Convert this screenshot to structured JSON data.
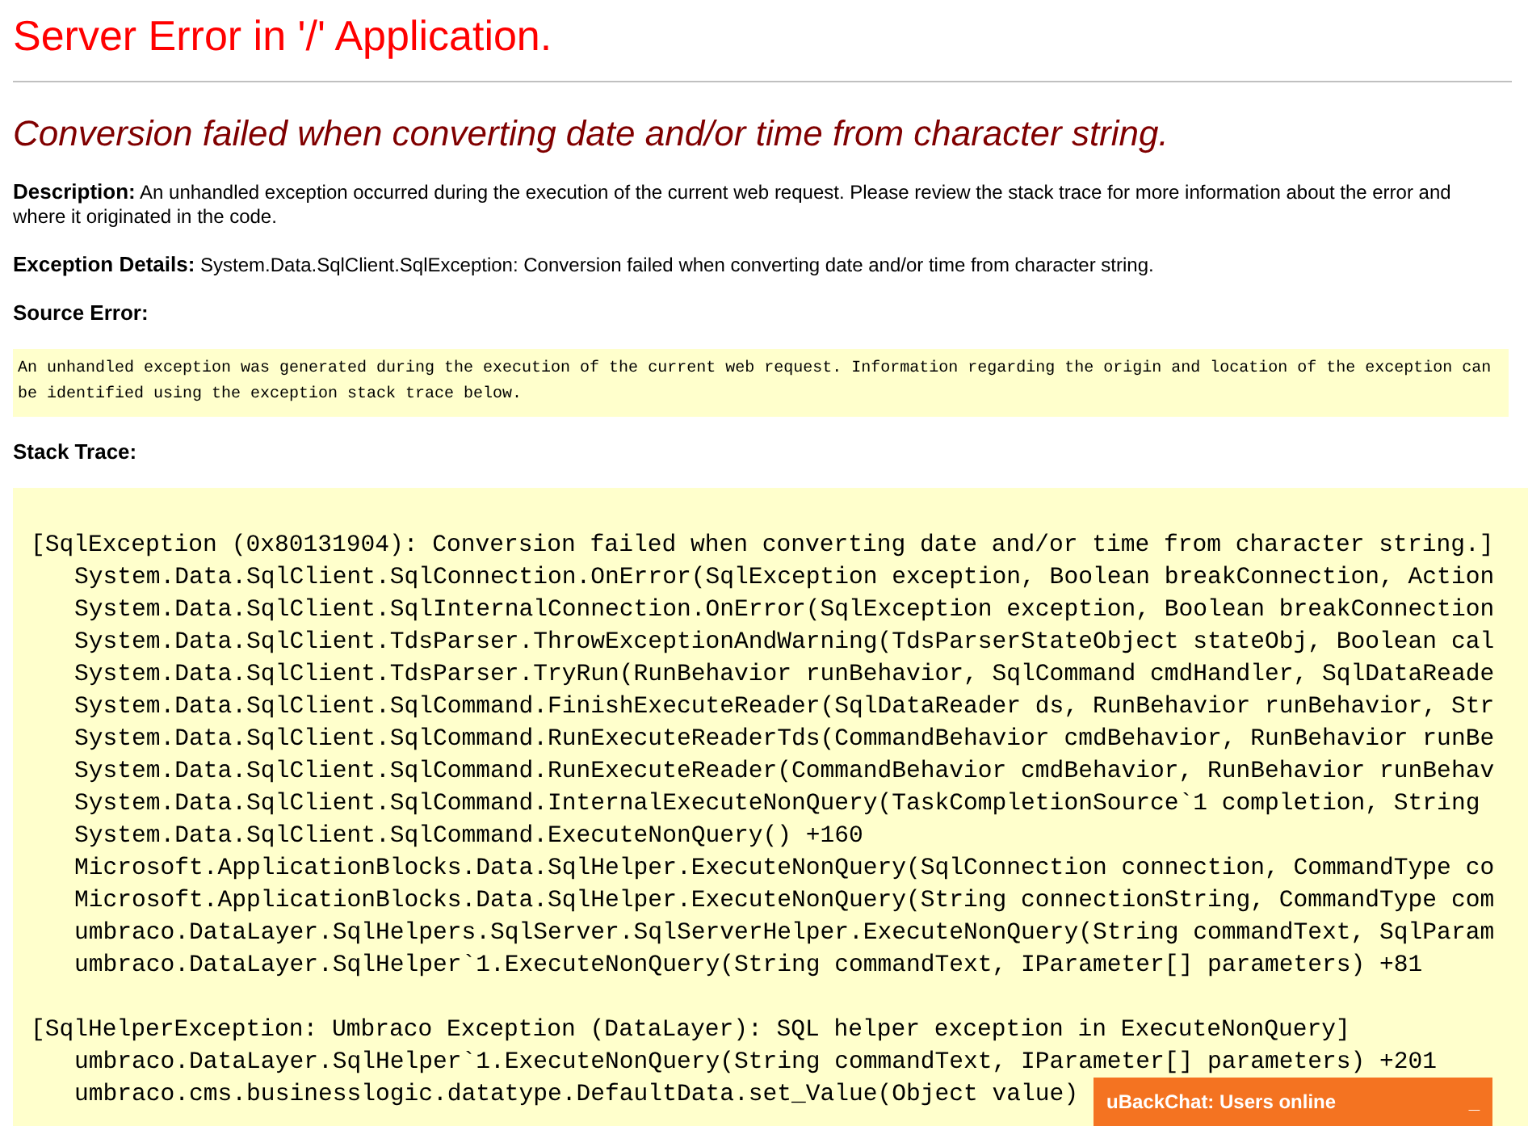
{
  "title": "Server Error in '/' Application.",
  "subtitle": "Conversion failed when converting date and/or time from character string.",
  "description": {
    "label": "Description:",
    "text": "An unhandled exception occurred during the execution of the current web request. Please review the stack trace for more information about the error and where it originated in the code."
  },
  "exception_details": {
    "label": "Exception Details:",
    "text": "System.Data.SqlClient.SqlException: Conversion failed when converting date and/or time from character string."
  },
  "source_error": {
    "label": "Source Error:",
    "text": "An unhandled exception was generated during the execution of the current web request. Information regarding the origin and location of the exception can be identified using the exception stack trace below."
  },
  "stack_trace": {
    "label": "Stack Trace:",
    "blocks": [
      {
        "header": "[SqlException (0x80131904): Conversion failed when converting date and/or time from character string.]",
        "lines": [
          "System.Data.SqlClient.SqlConnection.OnError(SqlException exception, Boolean breakConnection, Action",
          "System.Data.SqlClient.SqlInternalConnection.OnError(SqlException exception, Boolean breakConnection",
          "System.Data.SqlClient.TdsParser.ThrowExceptionAndWarning(TdsParserStateObject stateObj, Boolean cal",
          "System.Data.SqlClient.TdsParser.TryRun(RunBehavior runBehavior, SqlCommand cmdHandler, SqlDataReade",
          "System.Data.SqlClient.SqlCommand.FinishExecuteReader(SqlDataReader ds, RunBehavior runBehavior, Str",
          "System.Data.SqlClient.SqlCommand.RunExecuteReaderTds(CommandBehavior cmdBehavior, RunBehavior runBe",
          "System.Data.SqlClient.SqlCommand.RunExecuteReader(CommandBehavior cmdBehavior, RunBehavior runBehav",
          "System.Data.SqlClient.SqlCommand.InternalExecuteNonQuery(TaskCompletionSource`1 completion, String",
          "System.Data.SqlClient.SqlCommand.ExecuteNonQuery() +160",
          "Microsoft.ApplicationBlocks.Data.SqlHelper.ExecuteNonQuery(SqlConnection connection, CommandType co",
          "Microsoft.ApplicationBlocks.Data.SqlHelper.ExecuteNonQuery(String connectionString, CommandType com",
          "umbraco.DataLayer.SqlHelpers.SqlServer.SqlServerHelper.ExecuteNonQuery(String commandText, SqlParam",
          "umbraco.DataLayer.SqlHelper`1.ExecuteNonQuery(String commandText, IParameter[] parameters) +81"
        ]
      },
      {
        "header": "[SqlHelperException: Umbraco Exception (DataLayer): SQL helper exception in ExecuteNonQuery]",
        "lines": [
          "umbraco.DataLayer.SqlHelper`1.ExecuteNonQuery(String commandText, IParameter[] parameters) +201",
          "umbraco.cms.businesslogic.datatype.DefaultData.set_Value(Object value)"
        ]
      }
    ]
  },
  "chat_widget": {
    "title": "uBackChat: Users online",
    "minimize": "_"
  }
}
